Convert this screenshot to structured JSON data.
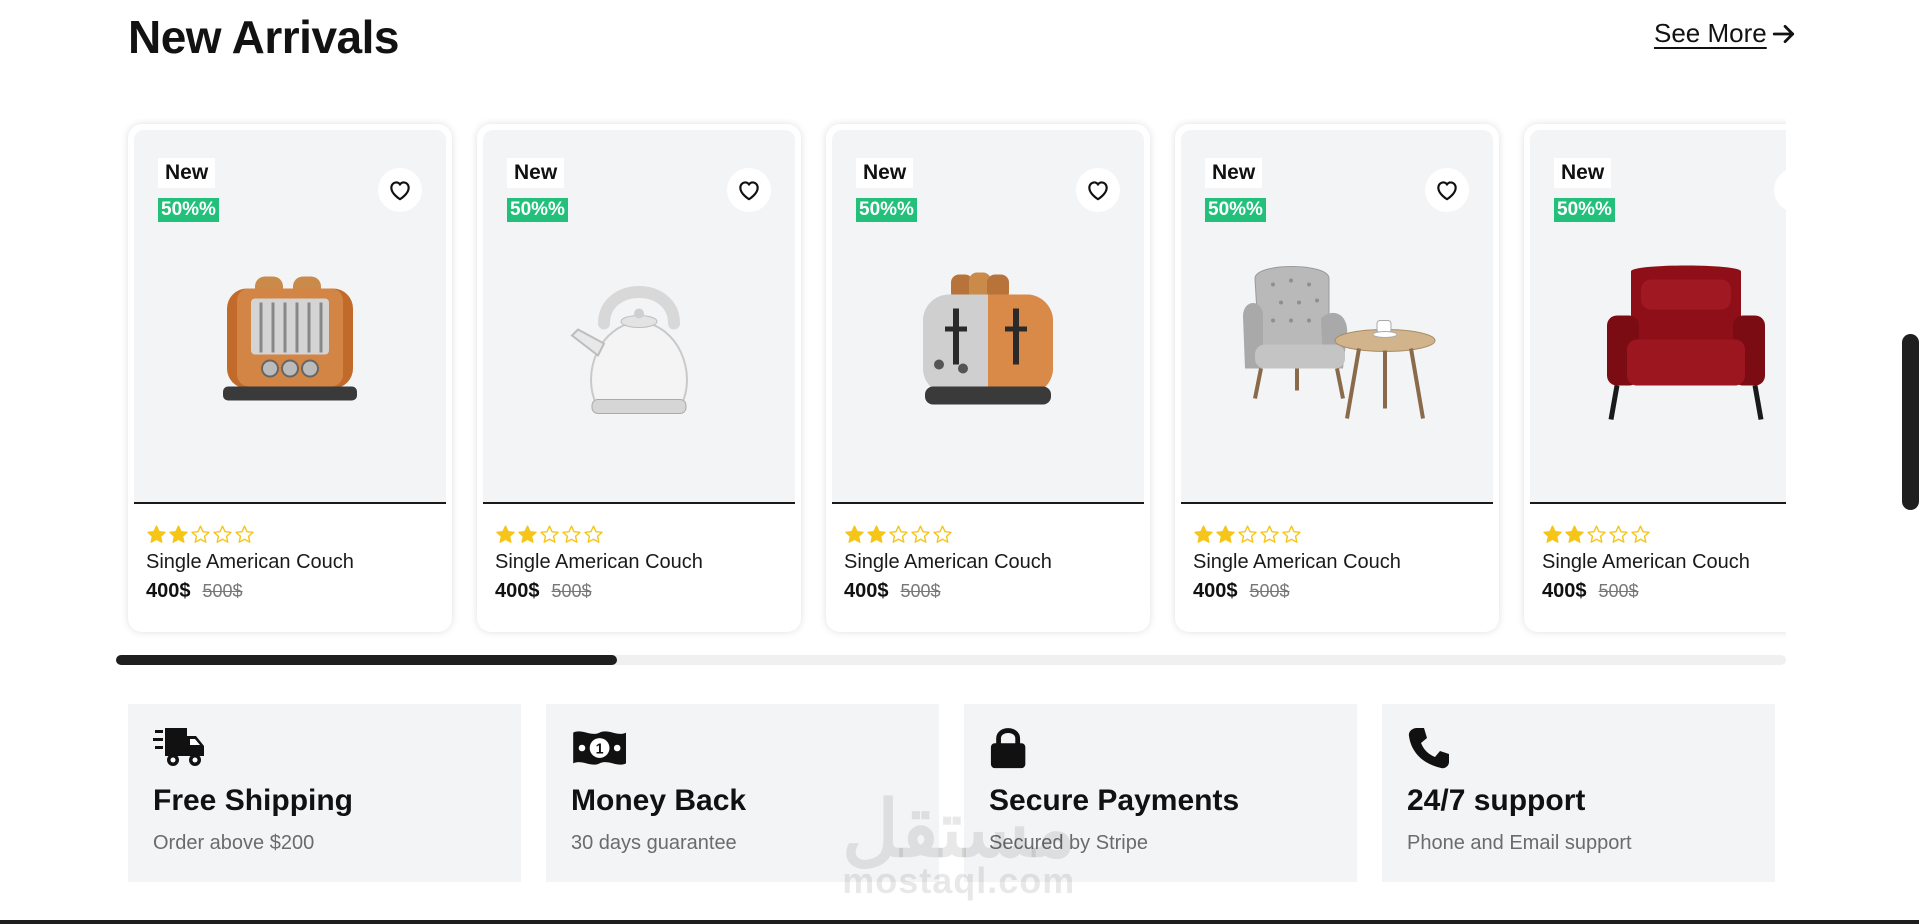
{
  "section": {
    "title": "New Arrivals",
    "see_more": "See More"
  },
  "products": [
    {
      "badge": "New",
      "discount": "50%%",
      "name": "Single American Couch",
      "price": "400$",
      "old_price": "500$",
      "rating": 2,
      "image": "copper-toaster"
    },
    {
      "badge": "New",
      "discount": "50%%",
      "name": "Single American Couch",
      "price": "400$",
      "old_price": "500$",
      "rating": 2,
      "image": "white-kettle"
    },
    {
      "badge": "New",
      "discount": "50%%",
      "name": "Single American Couch",
      "price": "400$",
      "old_price": "500$",
      "rating": 2,
      "image": "chrome-toaster"
    },
    {
      "badge": "New",
      "discount": "50%%",
      "name": "Single American Couch",
      "price": "400$",
      "old_price": "500$",
      "rating": 2,
      "image": "armchair-with-table"
    },
    {
      "badge": "New",
      "discount": "50%%",
      "name": "Single American Couch",
      "price": "400$",
      "old_price": "500$",
      "rating": 2,
      "image": "red-armchair"
    }
  ],
  "carousel": {
    "scroll_progress": 0.3
  },
  "features": [
    {
      "icon": "truck-icon",
      "title": "Free Shipping",
      "subtitle": "Order above $200"
    },
    {
      "icon": "money-icon",
      "title": "Money Back",
      "subtitle": "30 days guarantee"
    },
    {
      "icon": "lock-icon",
      "title": "Secure Payments",
      "subtitle": "Secured by Stripe"
    },
    {
      "icon": "phone-icon",
      "title": "24/7 support",
      "subtitle": "Phone and Email support"
    }
  ],
  "watermark": {
    "arabic": "مستقل",
    "latin": "mostaql.com"
  },
  "colors": {
    "star": "#f5c518",
    "discount_badge": "#22c07a",
    "card_bg": "#f3f4f6"
  }
}
